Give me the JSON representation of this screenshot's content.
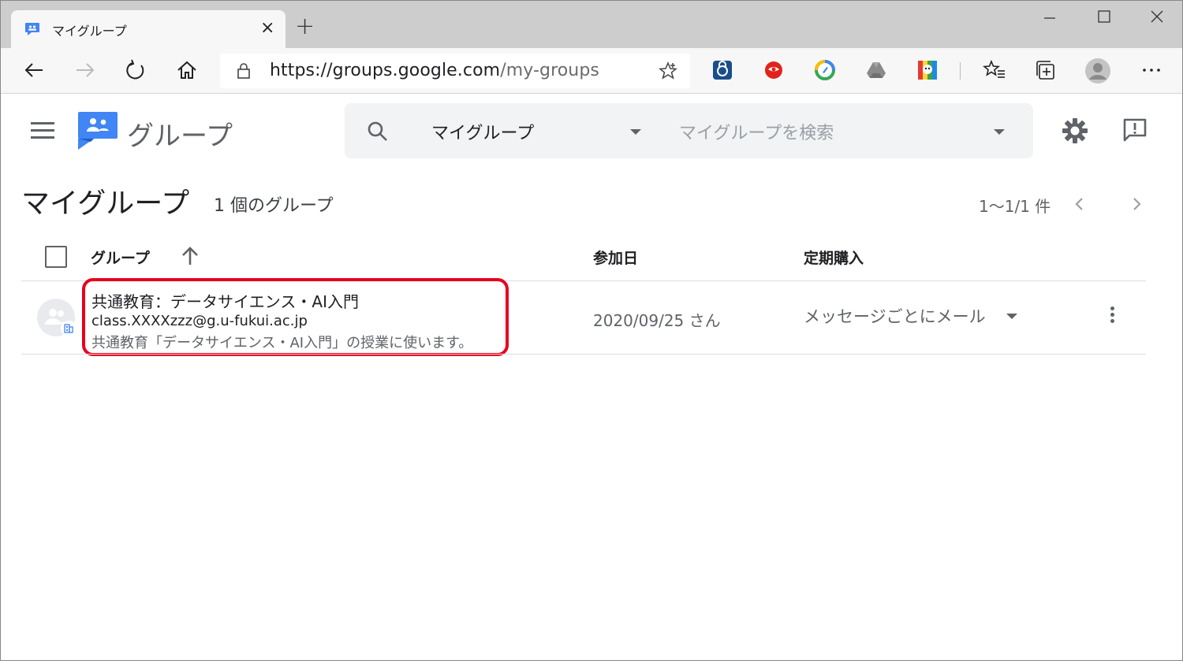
{
  "browser": {
    "tab_title": "マイグループ",
    "tab_close": "×",
    "new_tab": "+",
    "url_host": "https://groups.google.com",
    "url_path": "/my-groups"
  },
  "app": {
    "brand": "グループ",
    "search": {
      "scope": "マイグループ",
      "placeholder": "マイグループを検索"
    }
  },
  "page": {
    "title": "マイグループ",
    "group_count": "1 個のグループ",
    "pager": "1〜1/1 件"
  },
  "table": {
    "columns": [
      "グループ",
      "参加日",
      "定期購入"
    ],
    "rows": [
      {
        "name": "共通教育：データサイエンス・AI入門",
        "email": "class.XXXXzzz@g.u-fukui.ac.jp",
        "description": "共通教育「データサイエンス・AI入門」の授業に使います。",
        "joined": "2020/09/25 さん",
        "subscription": "メッセージごとにメール"
      }
    ]
  },
  "colors": {
    "brand_blue": "#4285f4",
    "highlight_red": "#e8001c",
    "tab_strip": "#cdcdcd"
  }
}
